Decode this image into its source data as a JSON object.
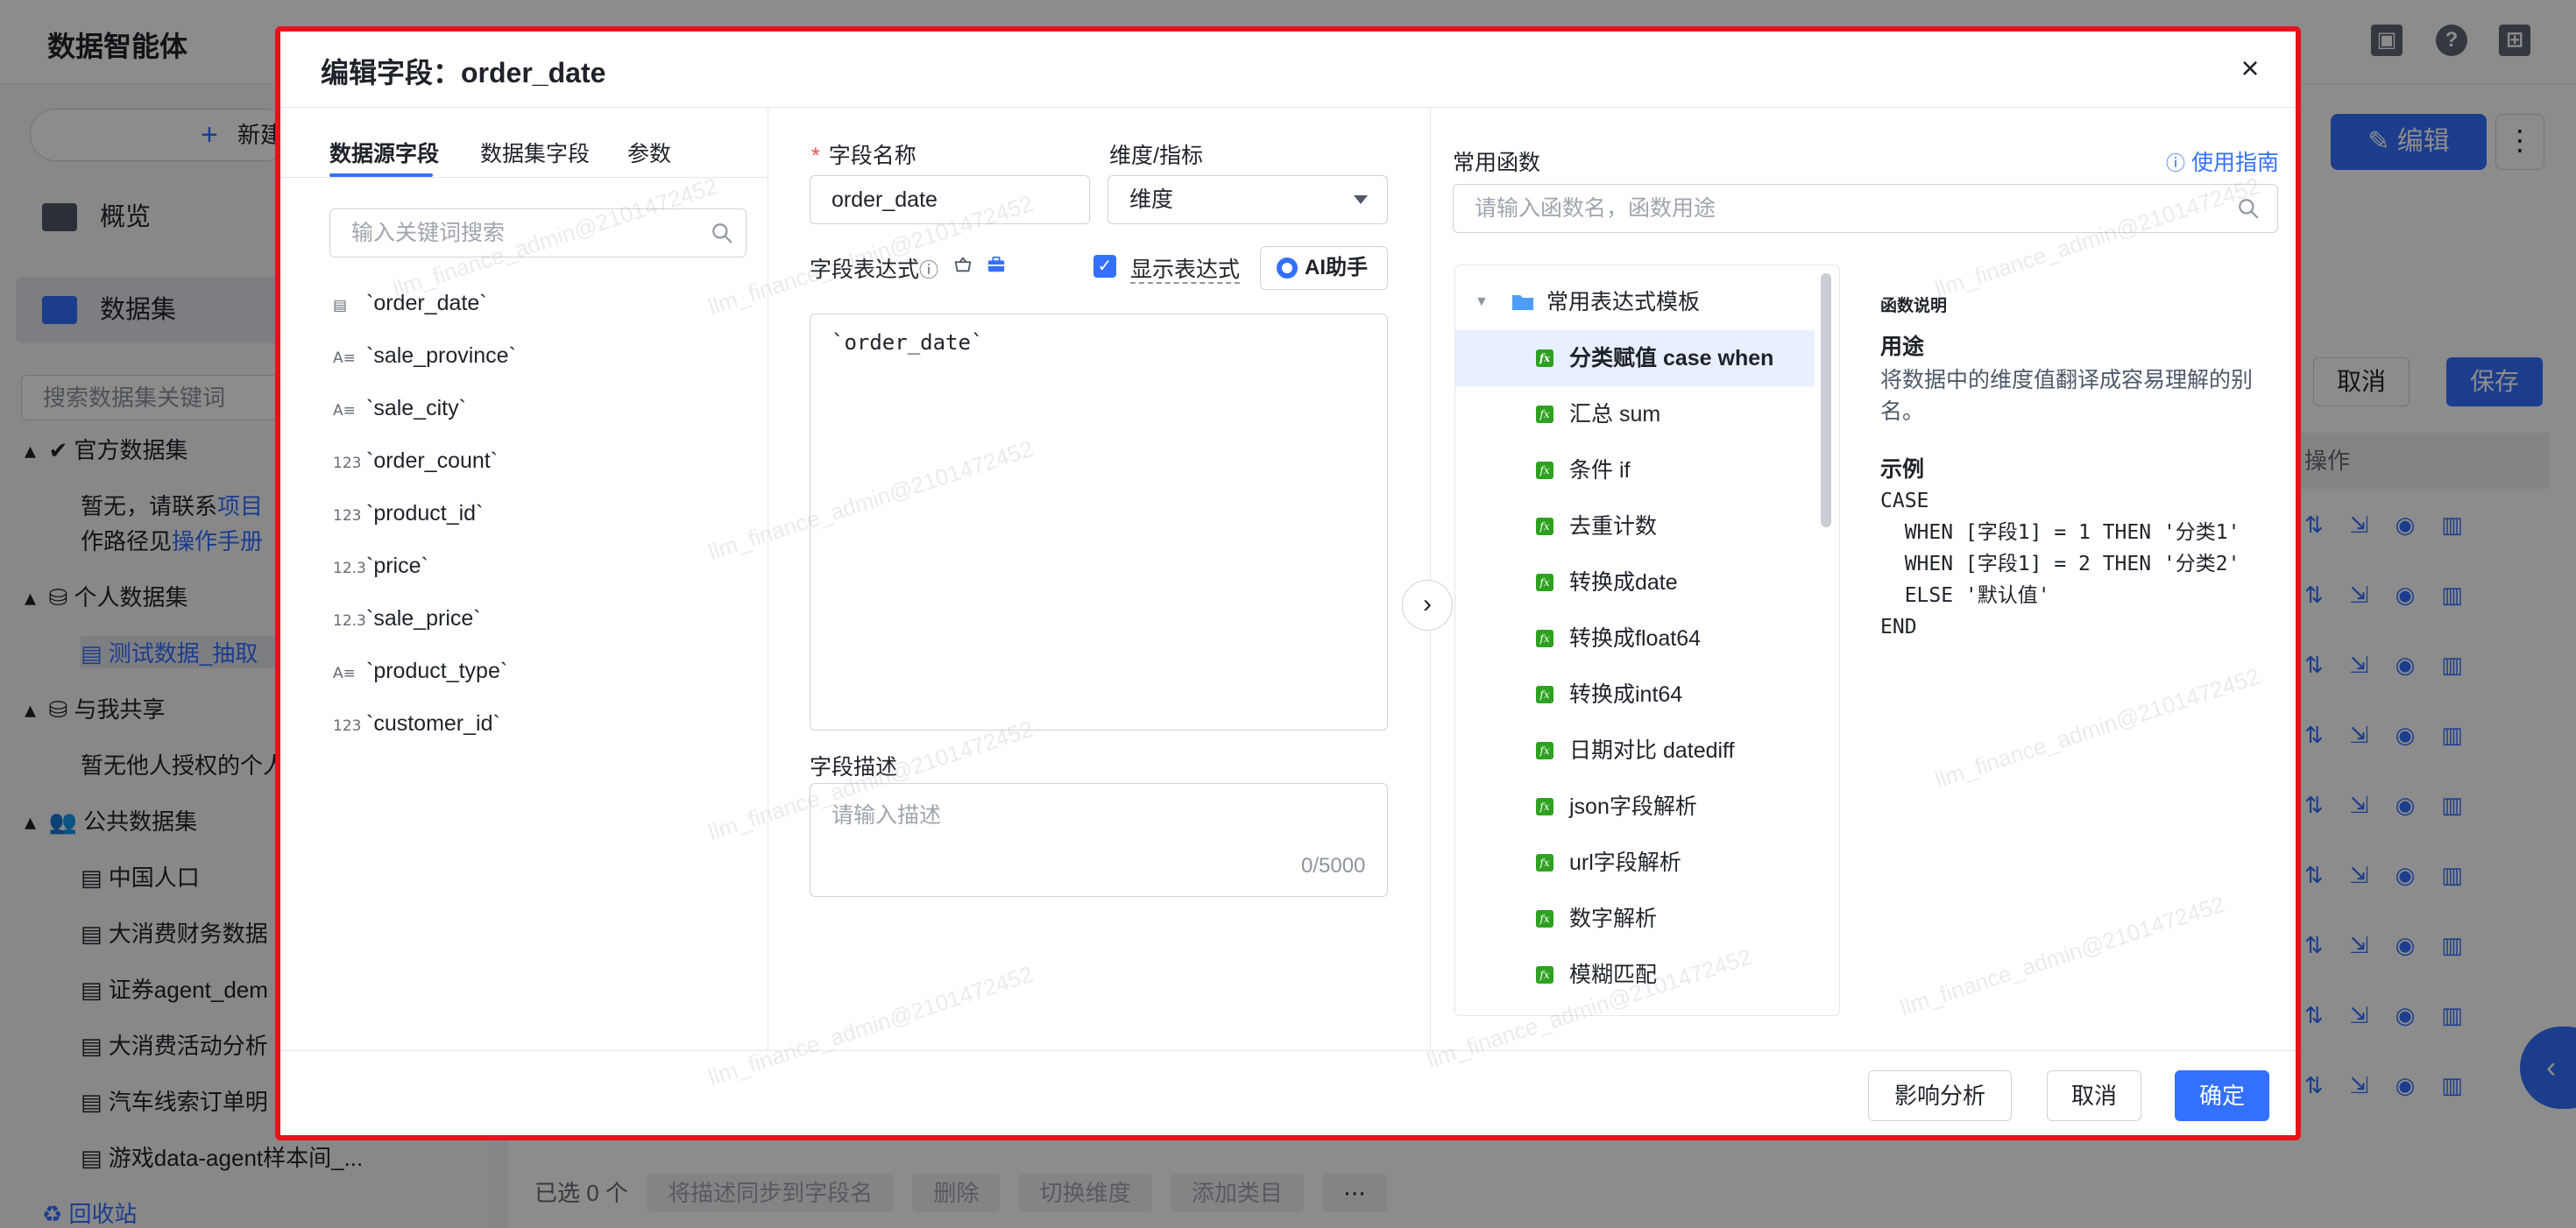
{
  "app": {
    "title": "数据智能体",
    "new_button": "新建",
    "nav": [
      {
        "label": "概览"
      },
      {
        "label": "数据集"
      }
    ],
    "sidebar_search_placeholder": "搜索数据集关键词",
    "tree": {
      "official": "官方数据集",
      "official_note_1": "暂无，请联系",
      "official_note_link": "项目",
      "official_note_2": "作路径见",
      "official_manual_link": "操作手册",
      "personal": "个人数据集",
      "personal_item": "测试数据_抽取",
      "shared": "与我共享",
      "shared_note": "暂无他人授权的个人",
      "public": "公共数据集",
      "public_items": [
        "中国人口",
        "大消费财务数据",
        "证券agent_dem",
        "大消费活动分析",
        "汽车线索订单明",
        "游戏data-agent样本间_..."
      ],
      "recycle": "回收站"
    },
    "edit_button": "编辑",
    "more_button": "⋮",
    "cancel_button": "取消",
    "save_button": "保存",
    "table_header_ops": "操作",
    "bottom_selected": "已选",
    "bottom_count": "0 个",
    "bottom_actions": [
      "将描述同步到字段名",
      "删除",
      "切换维度",
      "添加类目"
    ],
    "bottom_more": "⋯"
  },
  "modal": {
    "title": "编辑字段：order_date",
    "close_icon": "×",
    "tabs": [
      "数据源字段",
      "数据集字段",
      "参数"
    ],
    "left_search_placeholder": "输入关键词搜索",
    "fields": [
      {
        "type": "date",
        "type_label": "▤",
        "name": "`order_date`"
      },
      {
        "type": "string",
        "type_label": "A≡",
        "name": "`sale_province`"
      },
      {
        "type": "string",
        "type_label": "A≡",
        "name": "`sale_city`"
      },
      {
        "type": "int",
        "type_label": "123",
        "name": "`order_count`"
      },
      {
        "type": "int",
        "type_label": "123",
        "name": "`product_id`"
      },
      {
        "type": "float",
        "type_label": "12.3",
        "name": "`price`"
      },
      {
        "type": "float",
        "type_label": "12.3",
        "name": "`sale_price`"
      },
      {
        "type": "string",
        "type_label": "A≡",
        "name": "`product_type`"
      },
      {
        "type": "int",
        "type_label": "123",
        "name": "`customer_id`"
      }
    ],
    "field_name_label": "字段名称",
    "field_name_required": "*",
    "field_name_value": "order_date",
    "dim_metric_label": "维度/指标",
    "dim_metric_value": "维度",
    "expr_label": "字段表达式",
    "show_expr_label": "显示表达式",
    "show_expr_checked": true,
    "ai_button": "AI助手",
    "expression": "`order_date`",
    "desc_label": "字段描述",
    "desc_placeholder": "请输入描述",
    "desc_counter": "0/5000",
    "common_funcs_label": "常用函数",
    "guide_link": "使用指南",
    "func_search_placeholder": "请输入函数名，函数用途",
    "func_group": "常用表达式模板",
    "funcs": [
      "分类赋值 case when",
      "汇总 sum",
      "条件 if",
      "去重计数",
      "转换成date",
      "转换成float64",
      "转换成int64",
      "日期对比 datediff",
      "json字段解析",
      "url字段解析",
      "数字解析",
      "模糊匹配"
    ],
    "selected_func_index": 0,
    "desc_panel": {
      "title": "函数说明",
      "usage_h": "用途",
      "usage_text_1": "将数据中的维度值翻译成容易理解的别",
      "usage_text_2": "名。",
      "example_h": "示例",
      "example_code": "CASE\n  WHEN [字段1] = 1 THEN '分类1'\n  WHEN [字段1] = 2 THEN '分类2'\n  ELSE '默认值'\nEND"
    },
    "footer": {
      "impact_button": "影响分析",
      "cancel_button": "取消",
      "confirm_button": "确定"
    }
  },
  "watermark_text": "llm_finance_admin@2101472452",
  "colors": {
    "accent": "#3370ff",
    "highlight_border": "#e8121c",
    "fx_icon": "#2ea121"
  }
}
